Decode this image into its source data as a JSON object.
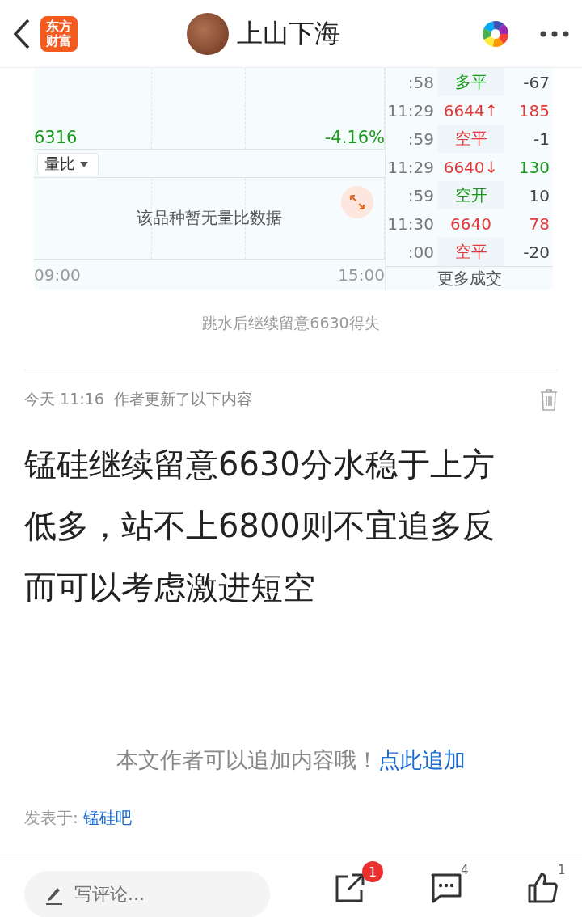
{
  "header": {
    "logo_line1": "东方",
    "logo_line2": "财富",
    "title": "上山下海"
  },
  "chart": {
    "price": "6316",
    "change": "-4.16%",
    "indicator": "量比",
    "empty_message": "该品种暂无量比数据",
    "time_start": "09:00",
    "time_end": "15:00",
    "trades": [
      {
        "time": ":58",
        "type": {
          "text": "多平",
          "color": "#1a9a1a"
        },
        "volume": {
          "text": "-67",
          "color": "#444444"
        }
      },
      {
        "time": "11:29",
        "type": {
          "text": "6644↑",
          "color": "#e03a3a"
        },
        "volume": {
          "text": "185",
          "color": "#e03a3a"
        }
      },
      {
        "time": ":59",
        "type": {
          "text": "空平",
          "color": "#e03a3a"
        },
        "volume": {
          "text": "-1",
          "color": "#444444"
        }
      },
      {
        "time": "11:29",
        "type": {
          "text": "6640↓",
          "color": "#e03a3a"
        },
        "volume": {
          "text": "130",
          "color": "#1a9a1a"
        }
      },
      {
        "time": ":59",
        "type": {
          "text": "空开",
          "color": "#1a9a1a"
        },
        "volume": {
          "text": "10",
          "color": "#444444"
        }
      },
      {
        "time": "11:30",
        "type": {
          "text": "6640",
          "color": "#e03a3a"
        },
        "volume": {
          "text": "78",
          "color": "#e03a3a"
        }
      },
      {
        "time": ":00",
        "type": {
          "text": "空平",
          "color": "#e03a3a"
        },
        "volume": {
          "text": "-20",
          "color": "#444444"
        }
      }
    ],
    "more": "更多成交"
  },
  "caption": "跳水后继续留意6630得失",
  "update": {
    "meta": "今天 11:16  作者更新了以下内容",
    "body": "锰硅继续留意6630分水稳于上方低多，站不上6800则不宜追多反而可以考虑激进短空"
  },
  "append": {
    "prompt": "本文作者可以追加内容哦！",
    "link": "点此追加"
  },
  "posted": {
    "label": "发表于:",
    "forum": "锰硅吧"
  },
  "bottom_bar": {
    "placeholder": "写评论...",
    "share_badge": "1",
    "comments": "4",
    "likes": "1"
  }
}
